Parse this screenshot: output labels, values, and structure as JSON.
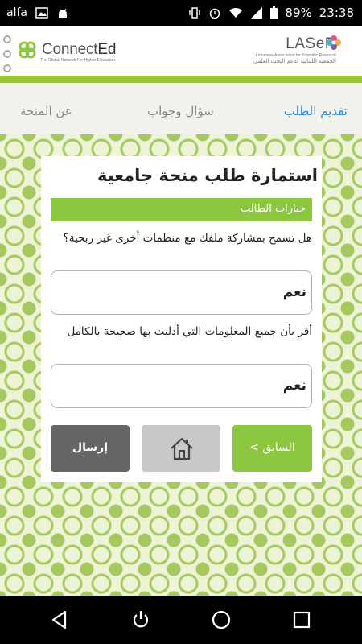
{
  "status_bar": {
    "carrier": "alfa",
    "battery": "89%",
    "time": "23:38",
    "icons": [
      "image-icon",
      "android-debug-icon",
      "vibrate-icon",
      "alarm-icon",
      "wifi-icon",
      "signal-icon",
      "battery-icon"
    ]
  },
  "header": {
    "left_logo_name": "Connect",
    "left_logo_name_suffix": "Ed",
    "left_logo_tagline": "The Global Network For Higher Education",
    "right_logo_name": "LASeR",
    "right_logo_english": "Lebanese Association for Scientific Research",
    "right_logo_arabic": "الجمعية اللبنانية لدعم البحث العلمي",
    "accent_color": "#9dc53a"
  },
  "tabs": [
    {
      "label": "تقديم الطلب",
      "active": true
    },
    {
      "label": "سؤال وجواب",
      "active": false
    },
    {
      "label": "عن المنحة",
      "active": false
    }
  ],
  "form": {
    "title": "استمارة طلب منحة جامعية",
    "section": "خيارات الطالب",
    "questions": [
      {
        "text": "هل تسمح بمشاركة ملفك مع منظمات أخرى غير ربحية؟",
        "value": "نعم"
      },
      {
        "text": "أقر بأن جميع المعلومات التي أدليت بها صحيحة بالكامل",
        "value": "نعم"
      }
    ],
    "buttons": {
      "submit": "إرسال",
      "previous": "< السابق",
      "home_icon": "home-icon"
    }
  },
  "nav_bar": {
    "icons": [
      "back-icon",
      "power-icon",
      "home-circle-icon",
      "recent-apps-icon"
    ]
  }
}
